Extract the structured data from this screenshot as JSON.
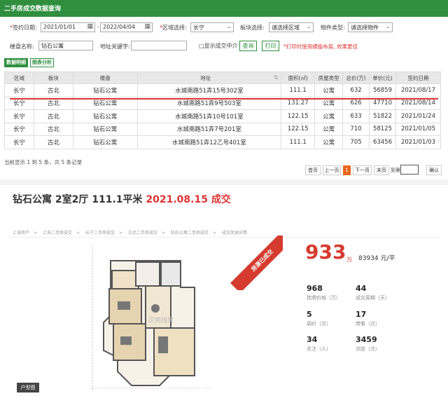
{
  "header": {
    "title": "二手房成交数据查询"
  },
  "filters": {
    "sign_date_label": "签约日期:",
    "date_from": "2021/01/01",
    "date_to": "2022/04/04",
    "region_label": "区域选择:",
    "region_value": "长宁",
    "block_label": "板块选择:",
    "block_value": "请选择区域",
    "property_type_label": "物件类型:",
    "property_type_value": "请选择物件",
    "building_label": "楼盘名称:",
    "building_value": "钻石公寓",
    "address_label": "地址关键字:",
    "address_value": "",
    "agent_checkbox_label": "显示成交中介",
    "query_button": "查询",
    "print_button": "打印",
    "print_tip": "*打印时使用横版布局, 效果更佳"
  },
  "tabs": [
    {
      "label": "数据明细"
    },
    {
      "label": "图表分析"
    }
  ],
  "table": {
    "columns": [
      "区域",
      "板块",
      "楼盘",
      "地址",
      "面积(㎡)",
      "房屋类型",
      "总价(万)",
      "单价(元)",
      "签约日期"
    ],
    "rows": [
      [
        "长宁",
        "古北",
        "钻石公寓",
        "水城南路51弄15号302室",
        "111.1",
        "公寓",
        "632",
        "56859",
        "2021/08/17"
      ],
      [
        "长宁",
        "古北",
        "钻石公寓",
        "水城南路51弄9号503室",
        "131.27",
        "公寓",
        "626",
        "47710",
        "2021/08/14"
      ],
      [
        "长宁",
        "古北",
        "钻石公寓",
        "水城南路51弄10号101室",
        "122.15",
        "公寓",
        "633",
        "51822",
        "2021/01/24"
      ],
      [
        "长宁",
        "古北",
        "钻石公寓",
        "水城南路51弄7号201室",
        "122.15",
        "公寓",
        "710",
        "58125",
        "2021/01/05"
      ],
      [
        "长宁",
        "古北",
        "钻石公寓",
        "水城南路51弄12乙号401室",
        "111.1",
        "公寓",
        "705",
        "63456",
        "2021/01/03"
      ]
    ],
    "summary": "当前显示 1 到 5 条，共 5 条记录"
  },
  "pager": {
    "first": "首页",
    "prev": "上一页",
    "current": "1",
    "next": "下一页",
    "last": "末页",
    "goto_label": "到第",
    "confirm": "确认"
  },
  "detail": {
    "title": "钻石公寓 2室2厅 111.1平米",
    "date_deal": "2021.08.15 成交",
    "breadcrumbs": [
      "上海房产",
      "上海二手房成交",
      "长宁二手房成交",
      "古北二手房成交",
      "钻石公寓二手房成交",
      "成交房源详情"
    ],
    "ribbon": "房源已成交",
    "price": "933",
    "price_unit": "万",
    "unit_price": "83934 元/平",
    "stats": [
      {
        "value": "968",
        "label": "挂牌价格（万）"
      },
      {
        "value": "44",
        "label": "成交周期（天）"
      },
      {
        "value": "5",
        "label": "调价（次）"
      },
      {
        "value": "17",
        "label": "带看（次）"
      },
      {
        "value": "34",
        "label": "关注（人）"
      },
      {
        "value": "3459",
        "label": "浏览（次）"
      }
    ],
    "plan_label": "户型图",
    "watermark": "贝壳找房"
  },
  "colors": {
    "brand_green": "#2f8f3f",
    "accent_red": "#d63b2f"
  }
}
